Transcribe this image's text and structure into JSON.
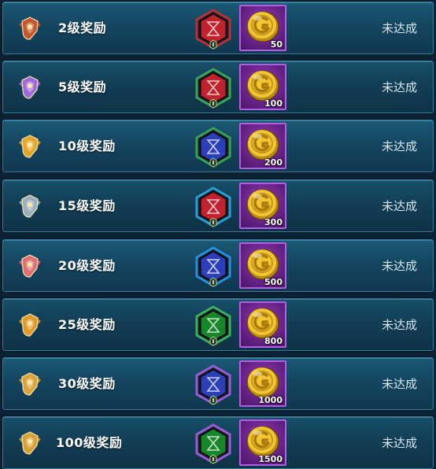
{
  "rewards": [
    {
      "label": "2级奖励",
      "quantity": "50",
      "status": "未达成",
      "rune_color": "#c0232d",
      "frame_color": "#b8323a",
      "badge_color": "#c4582c",
      "badge": "bronze-emblem"
    },
    {
      "label": "5级奖励",
      "quantity": "100",
      "status": "未达成",
      "rune_color": "#c0232d",
      "frame_color": "#3aa65a",
      "badge_color": "#a06ad8",
      "badge": "purple-emblem"
    },
    {
      "label": "10级奖励",
      "quantity": "200",
      "status": "未达成",
      "rune_color": "#2b3fb8",
      "frame_color": "#37a354",
      "badge_color": "#e3a52a",
      "badge": "gold-emblem"
    },
    {
      "label": "15级奖励",
      "quantity": "300",
      "status": "未达成",
      "rune_color": "#c0232d",
      "frame_color": "#2aa0d8",
      "badge_color": "#9ab0bc",
      "badge": "silver-emblem"
    },
    {
      "label": "20级奖励",
      "quantity": "500",
      "status": "未达成",
      "rune_color": "#2b3fb8",
      "frame_color": "#2a8fe0",
      "badge_color": "#e07070",
      "badge": "rose-emblem"
    },
    {
      "label": "25级奖励",
      "quantity": "800",
      "status": "未达成",
      "rune_color": "#17862a",
      "frame_color": "#3bb35c",
      "badge_color": "#e09a2a",
      "badge": "amber-emblem"
    },
    {
      "label": "30级奖励",
      "quantity": "1000",
      "status": "未达成",
      "rune_color": "#2b3fb8",
      "frame_color": "#9a5cd8",
      "badge_color": "#d9a53a",
      "badge": "winged-gold-emblem"
    },
    {
      "label": "100级奖励",
      "quantity": "1500",
      "status": "未达成",
      "rune_color": "#17862a",
      "frame_color": "#9a5cd8",
      "badge_color": "#d9a03a",
      "badge": "crown-emblem"
    }
  ],
  "icons": {
    "coin": "gold-coin-icon",
    "rune": "rune-gem-icon"
  }
}
